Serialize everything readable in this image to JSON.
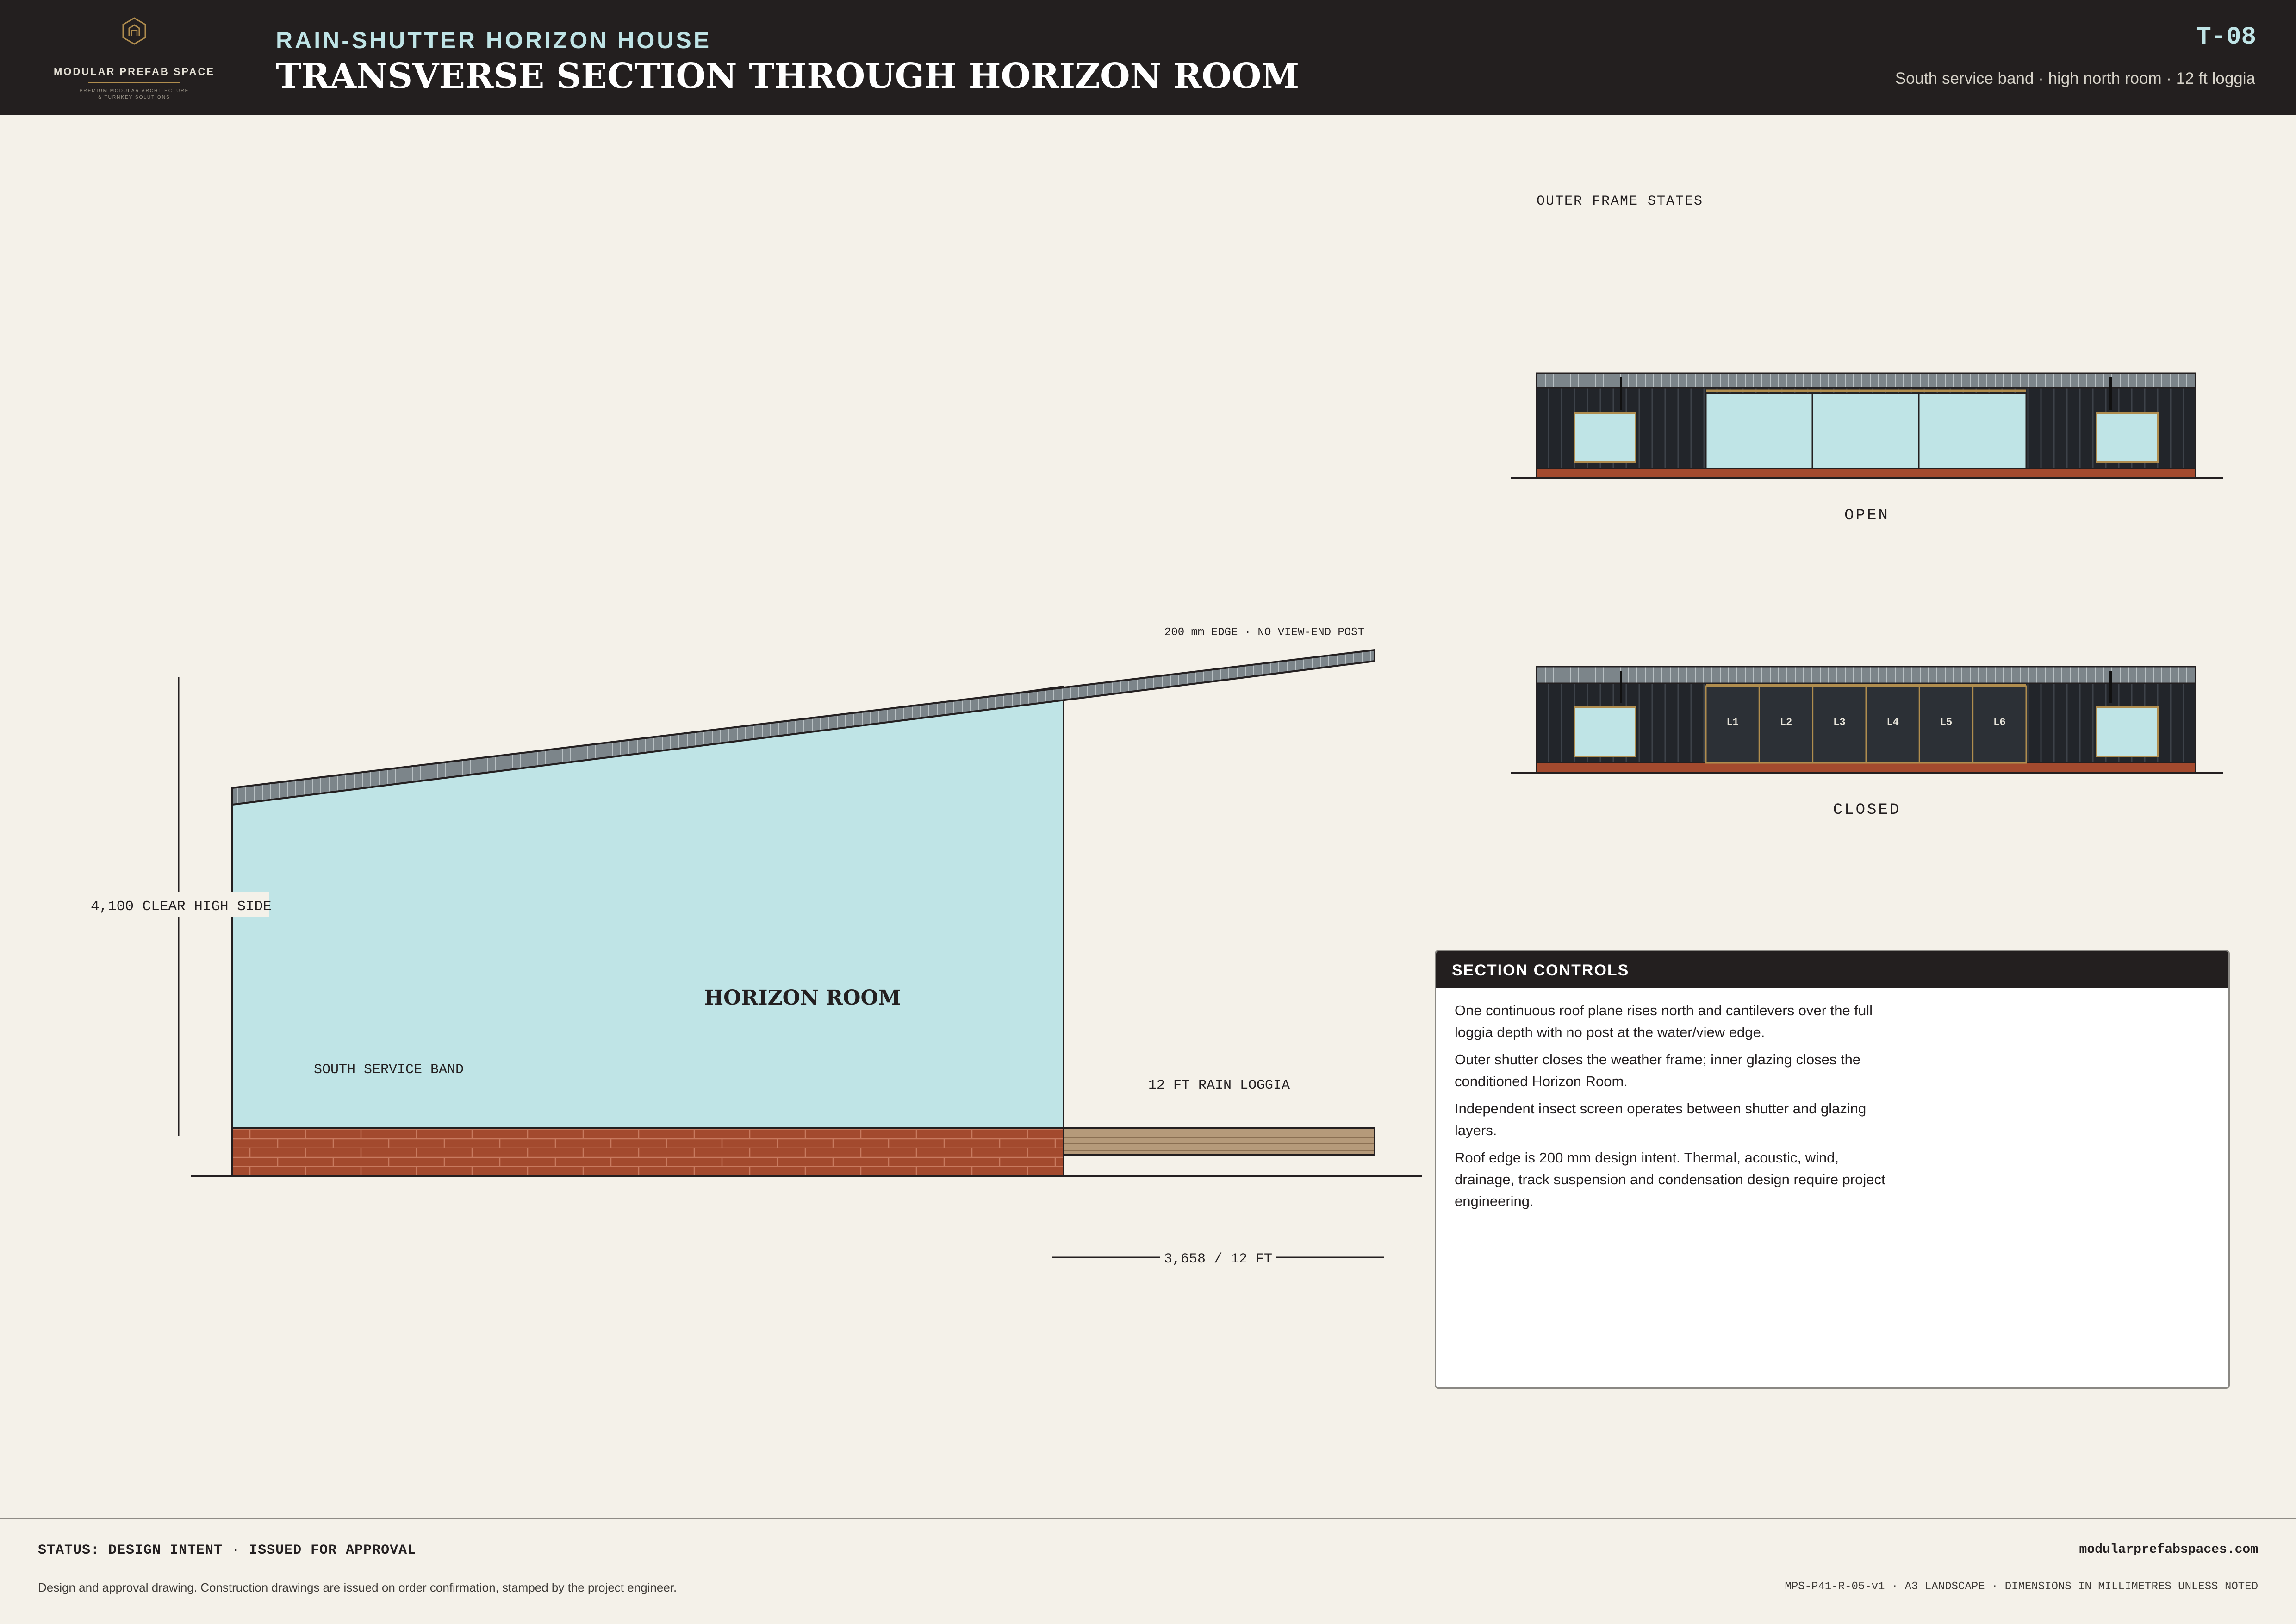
{
  "brand": {
    "name": "MODULAR PREFAB SPACE",
    "tagline_line1": "PREMIUM MODULAR ARCHITECTURE",
    "tagline_line2": "& TURNKEY SOLUTIONS",
    "accent_color": "#b08d4e"
  },
  "header": {
    "project": "RAIN-SHUTTER HORIZON HOUSE",
    "title": "TRANSVERSE SECTION THROUGH HORIZON ROOM",
    "sheet_number": "T-08",
    "subtitle": "South service band · high north room · 12 ft loggia",
    "background_color": "#231f1f",
    "accent_color": "#bfe4e6"
  },
  "section": {
    "roof_edge_note": "200 mm EDGE · NO VIEW-END POST",
    "height_dim": "4,100 CLEAR HIGH SIDE",
    "room_label": "HORIZON ROOM",
    "service_label": "SOUTH SERVICE BAND",
    "loggia_label": "12 FT RAIN LOGGIA",
    "loggia_dim": "3,658 / 12 FT",
    "room_color": "#bfe4e6",
    "brick_color": "#a34a2e",
    "deck_color": "#b59a7a"
  },
  "frame_states": {
    "title": "OUTER FRAME STATES",
    "open_label": "OPEN",
    "closed_label": "CLOSED",
    "louvers": [
      "L1",
      "L2",
      "L3",
      "L4",
      "L5",
      "L6"
    ]
  },
  "controls": {
    "title": "SECTION CONTROLS",
    "notes": [
      "One continuous roof plane rises north and cantilevers over the full loggia depth with no post at the water/view edge.",
      "Outer shutter closes the weather frame; inner glazing closes the conditioned Horizon Room.",
      "Independent insect screen operates between shutter and glazing layers.",
      "Roof edge is 200 mm design intent. Thermal, acoustic, wind, drainage, track suspension and condensation design require project engineering."
    ]
  },
  "footer": {
    "status": "STATUS: DESIGN INTENT · ISSUED FOR APPROVAL",
    "note": "Design and approval drawing. Construction drawings are issued on order confirmation, stamped by the project engineer.",
    "website": "modularprefabspaces.com",
    "doc_ref": "MPS-P41-R-05-v1 · A3 LANDSCAPE · DIMENSIONS IN MILLIMETRES UNLESS NOTED"
  }
}
